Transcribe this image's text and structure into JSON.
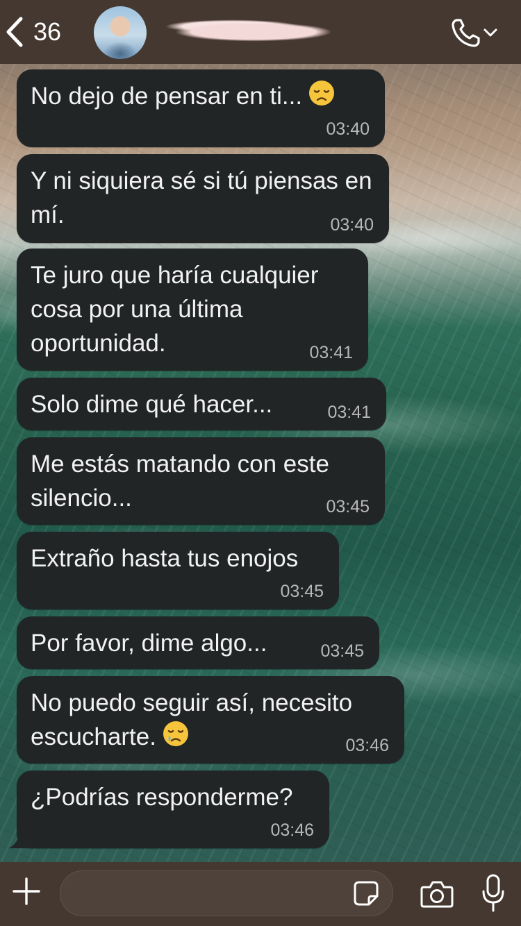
{
  "header": {
    "back_count": "36",
    "contact_name": "",
    "avatar": "avatar-photo",
    "icons": {
      "back": "chevron-left-icon",
      "call": "phone-icon",
      "call_menu": "chevron-down-icon"
    }
  },
  "messages": [
    {
      "text": "No dejo de pensar en ti...",
      "emoji": "disappointed-face",
      "time": "03:40"
    },
    {
      "text": "Y ni siquiera sé si tú piensas en mí.",
      "time": "03:40"
    },
    {
      "text": "Te juro que haría cualquier cosa por una última oportunidad.",
      "time": "03:41"
    },
    {
      "text": "Solo dime qué hacer...",
      "time": "03:41"
    },
    {
      "text": "Me estás matando con este silencio...",
      "time": "03:45"
    },
    {
      "text": "Extraño hasta tus enojos",
      "time": "03:45"
    },
    {
      "text": "Por favor, dime algo...",
      "time": "03:45"
    },
    {
      "text": "No puedo seguir así, necesito escucharte.",
      "emoji": "crying-face",
      "time": "03:46"
    },
    {
      "text": "¿Podrías responderme?",
      "time": "03:46"
    }
  ],
  "input_bar": {
    "message_value": "",
    "icons": {
      "add": "plus-icon",
      "sticker": "sticker-icon",
      "camera": "camera-icon",
      "mic": "microphone-icon"
    }
  },
  "colors": {
    "header_bg": "#453830",
    "bubble_bg": "#222526",
    "timestamp": "#b8b8b8"
  }
}
